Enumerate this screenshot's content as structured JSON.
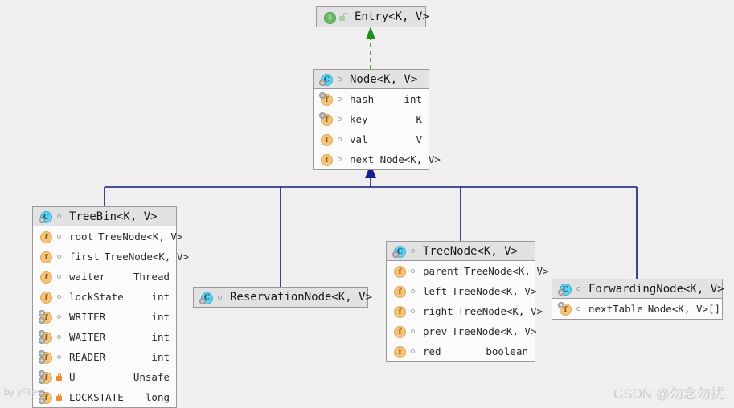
{
  "diagram": {
    "kind": "uml-class-diagram",
    "colors": {
      "background": "#f0eeee",
      "box_fill": "#fbfbfb",
      "header_fill": "#e2e2e2",
      "box_border": "#9a9a9a",
      "inheritance_line": "#0d1a78",
      "realization_line": "#1a8f1a",
      "interface_icon": "#6aba6a",
      "class_icon": "#63d0f0",
      "field_icon": "#f5c37a",
      "private_lock": "#f08a2a"
    }
  },
  "classes": [
    {
      "id": "entry",
      "name": "Entry<K, V>",
      "stereotype": "interface",
      "icon": "interface-icon",
      "header_marker": "unlock-icon",
      "fields": []
    },
    {
      "id": "node",
      "name": "Node<K, V>",
      "stereotype": "class",
      "icon": "class-icon",
      "fields": [
        {
          "name": "hash",
          "type": "int",
          "icon": "field-final-icon",
          "visibility": "public"
        },
        {
          "name": "key",
          "type": "K",
          "icon": "field-final-icon",
          "visibility": "public"
        },
        {
          "name": "val",
          "type": "V",
          "icon": "field-icon",
          "visibility": "public"
        },
        {
          "name": "next Node<K, V>",
          "type": "",
          "icon": "field-icon",
          "visibility": "public"
        }
      ]
    },
    {
      "id": "treebin",
      "name": "TreeBin<K, V>",
      "stereotype": "class",
      "icon": "class-icon",
      "fields": [
        {
          "name": "root",
          "type": "TreeNode<K, V>",
          "icon": "field-icon",
          "visibility": "public"
        },
        {
          "name": "first",
          "type": "TreeNode<K, V>",
          "icon": "field-icon",
          "visibility": "public"
        },
        {
          "name": "waiter",
          "type": "Thread",
          "icon": "field-icon",
          "visibility": "public"
        },
        {
          "name": "lockState",
          "type": "int",
          "icon": "field-icon",
          "visibility": "public"
        },
        {
          "name": "WRITER",
          "type": "int",
          "icon": "field-static-icon",
          "visibility": "public"
        },
        {
          "name": "WAITER",
          "type": "int",
          "icon": "field-static-icon",
          "visibility": "public"
        },
        {
          "name": "READER",
          "type": "int",
          "icon": "field-static-icon",
          "visibility": "public"
        },
        {
          "name": "U",
          "type": "Unsafe",
          "icon": "field-static-icon",
          "visibility": "private"
        },
        {
          "name": "LOCKSTATE",
          "type": "long",
          "icon": "field-static-icon",
          "visibility": "private"
        }
      ]
    },
    {
      "id": "reservationnode",
      "name": "ReservationNode<K, V>",
      "stereotype": "class",
      "icon": "class-icon",
      "fields": []
    },
    {
      "id": "treenode",
      "name": "TreeNode<K, V>",
      "stereotype": "class",
      "icon": "class-icon",
      "fields": [
        {
          "name": "parent",
          "type": "TreeNode<K, V>",
          "icon": "field-icon",
          "visibility": "public"
        },
        {
          "name": "left",
          "type": "TreeNode<K, V>",
          "icon": "field-icon",
          "visibility": "public"
        },
        {
          "name": "right",
          "type": "TreeNode<K, V>",
          "icon": "field-icon",
          "visibility": "public"
        },
        {
          "name": "prev",
          "type": "TreeNode<K, V>",
          "icon": "field-icon",
          "visibility": "public"
        },
        {
          "name": "red",
          "type": "boolean",
          "icon": "field-icon",
          "visibility": "public"
        }
      ]
    },
    {
      "id": "forwardingnode",
      "name": "ForwardingNode<K, V>",
      "stereotype": "class",
      "icon": "class-icon",
      "fields": [
        {
          "name": "nextTable",
          "type": "Node<K, V>[]",
          "icon": "field-final-icon",
          "visibility": "public"
        }
      ]
    }
  ],
  "relations": [
    {
      "type": "realization",
      "from": "node",
      "to": "entry",
      "style": "dashed",
      "arrow": "closed-triangle"
    },
    {
      "type": "generalization",
      "from": "treebin",
      "to": "node",
      "style": "solid",
      "arrow": "closed-triangle"
    },
    {
      "type": "generalization",
      "from": "reservationnode",
      "to": "node",
      "style": "solid",
      "arrow": "closed-triangle"
    },
    {
      "type": "generalization",
      "from": "treenode",
      "to": "node",
      "style": "solid",
      "arrow": "closed-triangle"
    },
    {
      "type": "generalization",
      "from": "forwardingnode",
      "to": "node",
      "style": "solid",
      "arrow": "closed-triangle"
    }
  ],
  "watermarks": {
    "yfiles": "by yFiles",
    "csdn": "CSDN @勿念勿扰"
  }
}
